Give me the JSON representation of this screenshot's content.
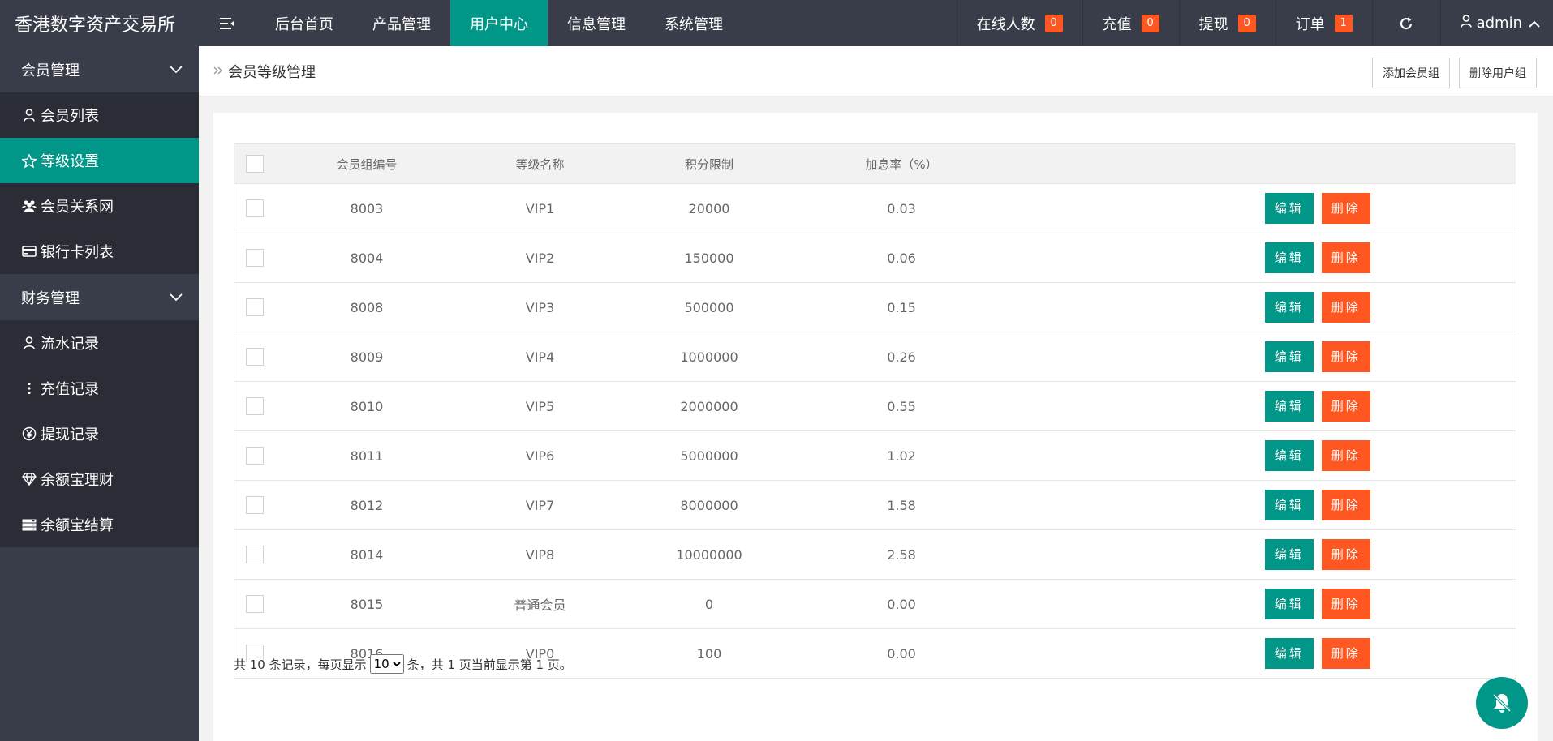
{
  "header": {
    "brand": "香港数字资产交易所",
    "nav": [
      {
        "label": "后台首页"
      },
      {
        "label": "产品管理"
      },
      {
        "label": "用户中心"
      },
      {
        "label": "信息管理"
      },
      {
        "label": "系统管理"
      }
    ],
    "stats": [
      {
        "label": "在线人数",
        "count": "0"
      },
      {
        "label": "充值",
        "count": "0"
      },
      {
        "label": "提现",
        "count": "0"
      },
      {
        "label": "订单",
        "count": "1"
      }
    ],
    "user": "admin"
  },
  "sidebar": {
    "groups": [
      {
        "label": "会员管理",
        "items": [
          {
            "label": "会员列表",
            "icon": "user-icon"
          },
          {
            "label": "等级设置",
            "icon": "star-icon"
          },
          {
            "label": "会员关系网",
            "icon": "group-icon"
          },
          {
            "label": "银行卡列表",
            "icon": "card-icon"
          }
        ]
      },
      {
        "label": "财务管理",
        "items": [
          {
            "label": "流水记录",
            "icon": "user-icon"
          },
          {
            "label": "充值记录",
            "icon": "more-vertical-icon"
          },
          {
            "label": "提现记录",
            "icon": "yen-icon"
          },
          {
            "label": "余额宝理财",
            "icon": "diamond-icon"
          },
          {
            "label": "余额宝结算",
            "icon": "server-icon"
          }
        ]
      }
    ]
  },
  "breadcrumb": {
    "title": "会员等级管理"
  },
  "actions": {
    "add": "添加会员组",
    "delete": "删除用户组"
  },
  "table": {
    "headers": [
      "会员组编号",
      "等级名称",
      "积分限制",
      "加息率（%）"
    ],
    "rows": [
      {
        "id": "8003",
        "name": "VIP1",
        "limit": "20000",
        "rate": "0.03"
      },
      {
        "id": "8004",
        "name": "VIP2",
        "limit": "150000",
        "rate": "0.06"
      },
      {
        "id": "8008",
        "name": "VIP3",
        "limit": "500000",
        "rate": "0.15"
      },
      {
        "id": "8009",
        "name": "VIP4",
        "limit": "1000000",
        "rate": "0.26"
      },
      {
        "id": "8010",
        "name": "VIP5",
        "limit": "2000000",
        "rate": "0.55"
      },
      {
        "id": "8011",
        "name": "VIP6",
        "limit": "5000000",
        "rate": "1.02"
      },
      {
        "id": "8012",
        "name": "VIP7",
        "limit": "8000000",
        "rate": "1.58"
      },
      {
        "id": "8014",
        "name": "VIP8",
        "limit": "10000000",
        "rate": "2.58"
      },
      {
        "id": "8015",
        "name": "普通会员",
        "limit": "0",
        "rate": "0.00"
      },
      {
        "id": "8016",
        "name": "VIP0",
        "limit": "100",
        "rate": "0.00"
      }
    ],
    "edit_label": "编辑",
    "delete_label": "删除"
  },
  "pager": {
    "prefix": "共 10 条记录，每页显示",
    "page_size": "10",
    "suffix": "条，共 1 页当前显示第 1 页。"
  },
  "colors": {
    "accent": "#009688",
    "danger": "#ff5722",
    "dark": "#393d49"
  }
}
